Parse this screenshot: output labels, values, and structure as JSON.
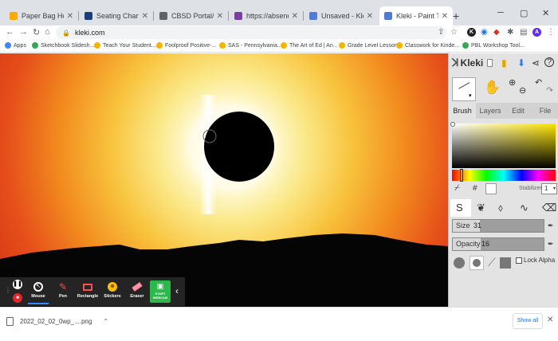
{
  "browser": {
    "tabs": [
      {
        "label": "Paper Bag Houses - G",
        "color": "#f9ab00"
      },
      {
        "label": "Seating Chart Art - R",
        "color": "#1a3d7c"
      },
      {
        "label": "CBSD Portal//Columbi",
        "color": "#5f6368"
      },
      {
        "label": "https://absenceemp.fr",
        "color": "#7b3fa0"
      },
      {
        "label": "Unsaved - Kleki - Pain",
        "color": "#4f7bd4"
      },
      {
        "label": "Kleki - Paint Tool",
        "color": "#4f7bd4"
      }
    ],
    "active_tab_index": 5,
    "new_tab": "+",
    "url": "kleki.com",
    "bookmarks": [
      {
        "label": "Apps",
        "color": "#4285f4"
      },
      {
        "label": "Sketchbook Slidesh...",
        "color": "#34a853"
      },
      {
        "label": "Teach Your Student...",
        "color": "#f4b400"
      },
      {
        "label": "Foolproof Positive-...",
        "color": "#f4b400"
      },
      {
        "label": "SAS - Pennsylvania...",
        "color": "#f4b400"
      },
      {
        "label": "The Art of Ed | An...",
        "color": "#f4b400"
      },
      {
        "label": "Grade Level Lesson...",
        "color": "#f4b400"
      },
      {
        "label": "Classwork for Kinde...",
        "color": "#f4b400"
      },
      {
        "label": "PBL Workshop Tool...",
        "color": "#34a853"
      }
    ],
    "extensions": [
      {
        "letter": "K",
        "color": "#202124"
      },
      {
        "letter": "A",
        "color": "#5f2eea"
      }
    ]
  },
  "zoom_toolbar": {
    "buttons": [
      {
        "label": "Mouse",
        "active": true
      },
      {
        "label": "Pen",
        "active": false
      },
      {
        "label": "Rectangle",
        "active": false
      },
      {
        "label": "Stickers",
        "active": false
      },
      {
        "label": "Eraser",
        "active": false
      },
      {
        "label": "START WEBCAM",
        "active": false
      }
    ]
  },
  "kleki": {
    "logo": "Kleki",
    "tabs": [
      "Brush",
      "Layers",
      "Edit",
      "File"
    ],
    "active_tab": "Brush",
    "color_hex_symbol": "#",
    "stabilizer_label": "Stabilizer",
    "stabilizer_value": "1",
    "size_label": "Size",
    "size_value": "31",
    "opacity_label": "Opacity",
    "opacity_value": "16",
    "lock_alpha_label": "Lock Alpha",
    "primary_color": "#ffffff"
  },
  "downloads": {
    "file_name": "2022_02_02_0wp_....png",
    "show_all": "Show all"
  }
}
